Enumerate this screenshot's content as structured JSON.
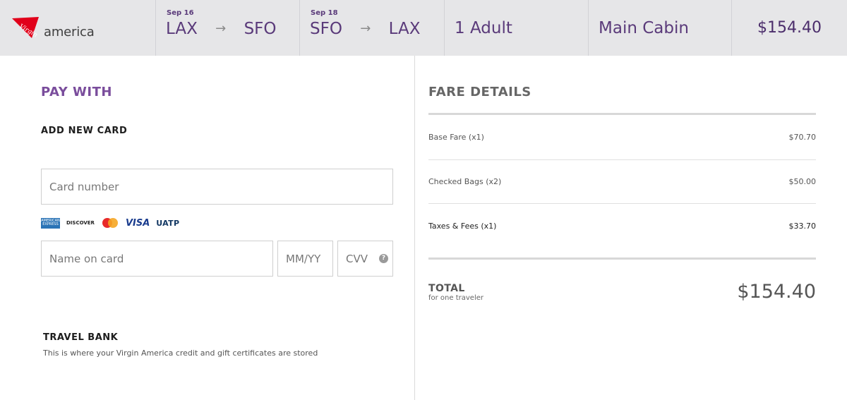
{
  "brand": {
    "name": "america",
    "logo_script": "Virgin",
    "logo_color": "#e1001a"
  },
  "header": {
    "segments": [
      {
        "date": "Sep 16",
        "from": "LAX",
        "to": "SFO"
      },
      {
        "date": "Sep 18",
        "from": "SFO",
        "to": "LAX"
      }
    ],
    "passengers": "1 Adult",
    "cabin": "Main Cabin",
    "price": "$154.40"
  },
  "payment": {
    "title": "PAY WITH",
    "add_card": "ADD NEW CARD",
    "card_number_placeholder": "Card number",
    "name_placeholder": "Name on card",
    "expiry_placeholder": "MM/YY",
    "cvv_placeholder": "CVV",
    "help_icon": "?",
    "card_logos": {
      "amex": "AMERICAN EXPRESS",
      "discover": "DISCOVER",
      "mastercard": "MasterCard",
      "visa": "VISA",
      "uatp": "UATP"
    }
  },
  "travel_bank": {
    "title": "TRAVEL BANK",
    "subtitle": "This is where your Virgin America credit and gift certificates are stored"
  },
  "fare": {
    "title": "FARE DETAILS",
    "rows": [
      {
        "label": "Base Fare (x1)",
        "value": "$70.70"
      },
      {
        "label": "Checked Bags (x2)",
        "value": "$50.00"
      },
      {
        "label": "Taxes & Fees (x1)",
        "value": "$33.70"
      }
    ],
    "total_label": "TOTAL",
    "total_sub": "for one traveler",
    "total_value": "$154.40"
  },
  "colors": {
    "accent": "#7a4d9c",
    "header_text": "#5a3a7a",
    "header_bg": "#e6e6e8"
  },
  "icons": {
    "arrow": "→"
  }
}
